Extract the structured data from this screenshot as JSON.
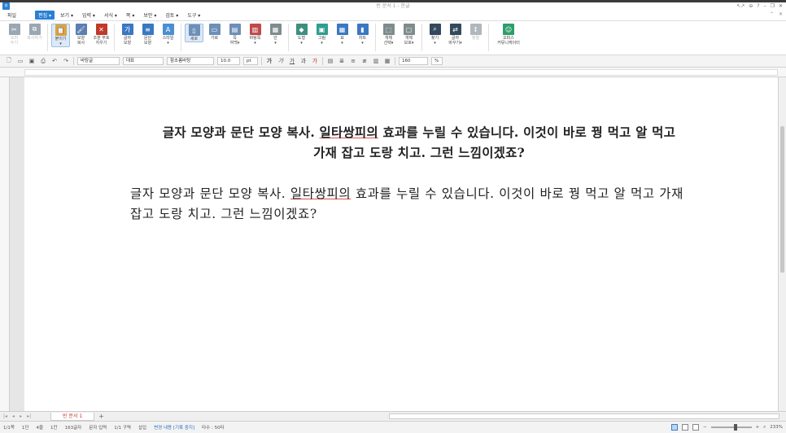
{
  "window": {
    "title": "빈 문서 1 - 한글",
    "controls": [
      "↖↗",
      "⊖",
      "?",
      "–",
      "❐",
      "✕"
    ]
  },
  "menubar": {
    "file": "파일",
    "items": [
      "편집 ▾",
      "보기 ▾",
      "입력 ▾",
      "서식 ▾",
      "쪽 ▾",
      "보안 ▾",
      "검토 ▾",
      "도구 ▾"
    ],
    "right": [
      "⌃",
      "✕"
    ]
  },
  "ribbon": {
    "buttons": [
      {
        "label": "오려\n두기",
        "icon": "scissors-icon",
        "glyph": "✂",
        "color": "#9aa7b3",
        "disabled": true
      },
      {
        "label": "복사하기",
        "icon": "copy-icon",
        "glyph": "⧉",
        "color": "#9aa7b3",
        "disabled": true
      },
      {
        "label": "붙이기\n▾",
        "icon": "paste-icon",
        "glyph": "📋",
        "color": "#d9a441",
        "selected": true
      },
      {
        "label": "모양\n복사",
        "icon": "format-painter-icon",
        "glyph": "🖌",
        "color": "#5a7fb0"
      },
      {
        "label": "조판 부호\n지우기",
        "icon": "clear-format-icon",
        "glyph": "✕",
        "color": "#c0392b"
      },
      {
        "label": "글자\n모양",
        "icon": "char-shape-icon",
        "glyph": "가",
        "color": "#3a78c2"
      },
      {
        "label": "문단\n모양",
        "icon": "para-shape-icon",
        "glyph": "≡",
        "color": "#3a78c2"
      },
      {
        "label": "스타일\n▾",
        "icon": "style-icon",
        "glyph": "A",
        "color": "#4a8fd4"
      },
      {
        "label": "세로",
        "icon": "portrait-icon",
        "glyph": "▯",
        "color": "#6d8fb8",
        "selected": true
      },
      {
        "label": "가로",
        "icon": "landscape-icon",
        "glyph": "▭",
        "color": "#6d8fb8"
      },
      {
        "label": "쪽\n여백▾",
        "icon": "margin-icon",
        "glyph": "▤",
        "color": "#6d8fb8"
      },
      {
        "label": "바탕쪽\n▾",
        "icon": "master-page-icon",
        "glyph": "▥",
        "color": "#c04a4a"
      },
      {
        "label": "단\n▾",
        "icon": "columns-icon",
        "glyph": "▦",
        "color": "#7f8c8d"
      },
      {
        "label": "도형\n▾",
        "icon": "shape-icon",
        "glyph": "◆",
        "color": "#3e8e7e"
      },
      {
        "label": "그림\n▾",
        "icon": "picture-icon",
        "glyph": "▣",
        "color": "#2f9e8f"
      },
      {
        "label": "표\n▾",
        "icon": "table-icon",
        "glyph": "▦",
        "color": "#3a78c2"
      },
      {
        "label": "차트\n▾",
        "icon": "chart-icon",
        "glyph": "▮",
        "color": "#3a78c2"
      },
      {
        "label": "개체\n선택▾",
        "icon": "select-object-icon",
        "glyph": "⬚",
        "color": "#7f8c8d"
      },
      {
        "label": "개체\n보호▾",
        "icon": "protect-object-icon",
        "glyph": "▢",
        "color": "#7f8c8d"
      },
      {
        "label": "찾기\n▾",
        "icon": "binoculars-icon",
        "glyph": "⌕",
        "color": "#34495e"
      },
      {
        "label": "글자\n바꾸기▾",
        "icon": "replace-icon",
        "glyph": "⇄",
        "color": "#34495e"
      },
      {
        "label": "정렬",
        "icon": "sort-icon",
        "glyph": "↕",
        "color": "#b0b7bd",
        "disabled": true
      },
      {
        "label": "오피스\n커뮤니케이터",
        "icon": "communicator-icon",
        "glyph": "☺",
        "color": "#2e9e6a",
        "xwide": true
      }
    ]
  },
  "formatbar": {
    "style_select": "바탕글",
    "lang_select": "대표",
    "font_select": "함초롬바탕",
    "size_value": "10.0",
    "size_unit": "pt",
    "char_buttons": [
      "가",
      "가",
      "가",
      "과",
      "가"
    ],
    "line_spacing": "160",
    "line_spacing_unit": "%"
  },
  "document": {
    "para1_a": "글자 모양과 문단 모양 복사. ",
    "para1_spell": "일타쌍피의",
    "para1_b": " 효과를 누릴 수 있습니다. 이것이 바로 꿩 먹고 알 먹고 가재 잡고 도랑 치고. 그런 느낌이겠죠?",
    "para2_a": "글자 모양과 문단 모양 복사. ",
    "para2_spell": "일타쌍피의",
    "para2_b": " 효과를 누릴 수 있습니다. 이것이 바로 꿩 먹고 알 먹고 가재 잡고 도랑 치고. 그런 느낌이겠죠?"
  },
  "tabbar": {
    "nav": [
      "|◂",
      "◂",
      "▸",
      "▸|"
    ],
    "doc_tab": "빈 문서 1",
    "add": "+"
  },
  "status": {
    "page": "1/1쪽",
    "section": "1단",
    "line": "4줄",
    "col": "1칸",
    "chars": "163글자",
    "input": "문자 입력",
    "region": "1/1 구역",
    "insert": "삽입",
    "track": "변경 내용 [기록 중지]",
    "typing": "타수 : 50타",
    "zoom": "233%"
  }
}
